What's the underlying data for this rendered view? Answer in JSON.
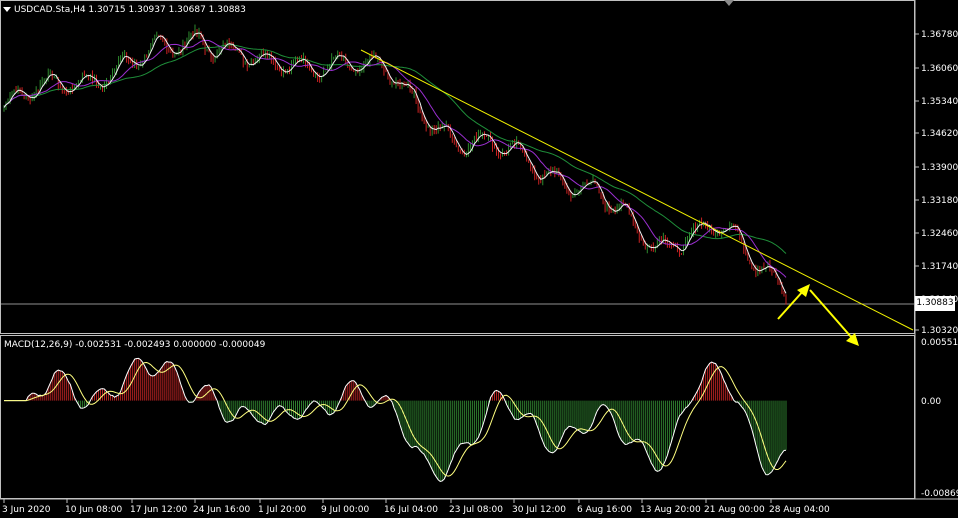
{
  "header": {
    "symbol_line": "USDCAD.Sta,H4  1.30715 1.30937 1.30687 1.30883",
    "menu_icon": "triangle-down-icon",
    "scroll_marker_icon": "triangle-marker-icon"
  },
  "price_axis": {
    "ticks": [
      "1.36780",
      "1.36060",
      "1.35340",
      "1.34620",
      "1.33900",
      "1.33180",
      "1.32460",
      "1.31740",
      "1.31040",
      "1.30320"
    ],
    "current_price": "1.30883",
    "range": [
      1.298,
      1.3718
    ]
  },
  "macd": {
    "title": "MACD(12,26,9) -0.002531 -0.002493 0.000000 -0.000049",
    "ticks": [
      "0.005518",
      "0.00",
      "-0.008694"
    ],
    "range": [
      -0.008694,
      0.005518
    ]
  },
  "time_axis": {
    "labels": [
      "3 Jun 2020",
      "10 Jun 08:00",
      "17 Jun 12:00",
      "24 Jun 16:00",
      "1 Jul 20:00",
      "9 Jul 00:00",
      "16 Jul 04:00",
      "23 Jul 08:00",
      "30 Jul 12:00",
      "6 Aug 16:00",
      "13 Aug 20:00",
      "21 Aug 00:00",
      "28 Aug 04:00"
    ]
  },
  "colors": {
    "background": "#000000",
    "bull_candle": "#2e8b2e",
    "bear_candle": "#cc2222",
    "close_line": "#e8e890",
    "ma_fast": "#f0f0f0",
    "ma_mid": "#9a2fd0",
    "ma_slow": "#1f8f3a",
    "trendline": "#f2f200",
    "arrows": "#ffff00",
    "macd_pos_hist": "#b22222",
    "macd_neg_hist": "#2e7d2e",
    "macd_line": "#ffffff",
    "signal_line": "#ffff80",
    "grid_lines": "#c0c0c0"
  },
  "chart_data": {
    "type": "line",
    "title": "USDCAD.Sta,H4",
    "x": [
      "3 Jun 2020",
      "10 Jun 08:00",
      "17 Jun 12:00",
      "24 Jun 16:00",
      "1 Jul 20:00",
      "9 Jul 00:00",
      "16 Jul 04:00",
      "23 Jul 08:00",
      "30 Jul 12:00",
      "6 Aug 16:00",
      "13 Aug 20:00",
      "21 Aug 00:00",
      "28 Aug 04:00"
    ],
    "series": [
      {
        "values": [
          1.3505,
          1.357,
          1.3605,
          1.368,
          1.3595,
          1.362,
          1.357,
          1.342,
          1.339,
          1.33,
          1.319,
          1.3215,
          1.3088
        ]
      }
    ],
    "ylim": [
      1.298,
      1.3718
    ],
    "macd_ylim": [
      -0.008694,
      0.005518
    ]
  }
}
